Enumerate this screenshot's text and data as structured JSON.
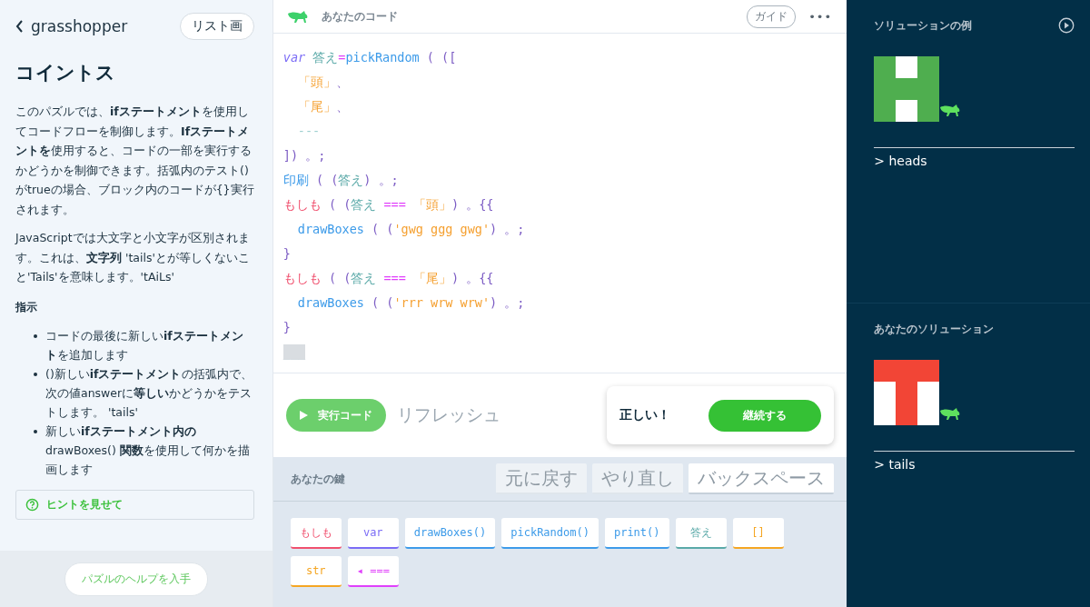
{
  "left": {
    "back_label": "grasshopper",
    "list_button": "リスト画",
    "title": "コイントス",
    "paragraphs": [
      "このパズルでは、**ifステートメント**を使用してコードフローを制御します。**Ifステートメントを**使用すると、コードの一部を実行するかどうかを制御できます。括弧内のテスト()がtrueの場合、ブロック内のコードが{}実行されます。",
      "JavaScriptでは大文字と小文字が区別されます。これは、**文字列** 'tails'とが等しくないこと'Tails'を意味します。'tAiLs'"
    ],
    "instructions_heading": "指示",
    "instructions": [
      "コードの最後に新しい**ifステートメント**を追加します",
      "()新しい**ifステートメント**の括弧内で、次の値answerに**等しい**かどうかをテストします。 'tails'",
      "新しい**ifステートメント内の** drawBoxes() **関数**を使用して何かを描画します"
    ],
    "hint_button": "ヒントを見せて",
    "help_button": "パズルのヘルプを入手"
  },
  "editor": {
    "title": "あなたのコード",
    "guide_button": "ガイド",
    "menu_button": "•••",
    "lines": [
      {
        "indent": false,
        "tokens": [
          {
            "kind": "var",
            "text": "var"
          },
          {
            "kind": "ident",
            "text": " 答え"
          },
          {
            "kind": "op",
            "text": "="
          },
          {
            "kind": "func",
            "text": "pickRandom"
          },
          {
            "kind": "punct",
            "text": " ( (["
          }
        ]
      },
      {
        "indent": true,
        "tokens": [
          {
            "kind": "str",
            "text": "「頭」"
          },
          {
            "kind": "punct",
            "text": "、"
          }
        ]
      },
      {
        "indent": true,
        "tokens": [
          {
            "kind": "str",
            "text": "「尾」"
          },
          {
            "kind": "punct",
            "text": "、"
          }
        ]
      },
      {
        "indent": true,
        "tokens": [
          {
            "kind": "slot",
            "text": "---"
          }
        ]
      },
      {
        "indent": false,
        "tokens": [
          {
            "kind": "punct",
            "text": "]) 。;"
          }
        ]
      },
      {
        "indent": false,
        "tokens": [
          {
            "kind": "func",
            "text": "印刷"
          },
          {
            "kind": "punct",
            "text": " ( ("
          },
          {
            "kind": "ident",
            "text": "答え"
          },
          {
            "kind": "punct",
            "text": ") 。;"
          }
        ]
      },
      {
        "indent": false,
        "tokens": [
          {
            "kind": "kw",
            "text": "もしも"
          },
          {
            "kind": "punct",
            "text": " ( ("
          },
          {
            "kind": "ident",
            "text": "答え"
          },
          {
            "kind": "op",
            "text": " === "
          },
          {
            "kind": "str",
            "text": "「頭」"
          },
          {
            "kind": "punct",
            "text": ") 。{{"
          }
        ]
      },
      {
        "indent": true,
        "tokens": [
          {
            "kind": "func",
            "text": "drawBoxes"
          },
          {
            "kind": "punct",
            "text": " ( ("
          },
          {
            "kind": "str",
            "text": "'gwg ggg gwg'"
          },
          {
            "kind": "punct",
            "text": ") 。;"
          }
        ]
      },
      {
        "indent": false,
        "tokens": [
          {
            "kind": "punct",
            "text": "}"
          }
        ]
      },
      {
        "indent": false,
        "tokens": [
          {
            "kind": "kw",
            "text": "もしも"
          },
          {
            "kind": "punct",
            "text": " ( ("
          },
          {
            "kind": "ident",
            "text": "答え"
          },
          {
            "kind": "op",
            "text": " === "
          },
          {
            "kind": "str",
            "text": "「尾」"
          },
          {
            "kind": "punct",
            "text": ") 。{{"
          }
        ]
      },
      {
        "indent": true,
        "tokens": [
          {
            "kind": "func",
            "text": "drawBoxes"
          },
          {
            "kind": "punct",
            "text": " ( ("
          },
          {
            "kind": "str",
            "text": "'rrr wrw wrw'"
          },
          {
            "kind": "punct",
            "text": ") 。;"
          }
        ]
      },
      {
        "indent": false,
        "tokens": [
          {
            "kind": "punct",
            "text": "}"
          }
        ]
      },
      {
        "indent": false,
        "tokens": [
          {
            "kind": "cursor",
            "text": "___"
          }
        ]
      }
    ],
    "run_button": "実行コード",
    "refresh_button": "リフレッシュ",
    "result": {
      "message": "正しい！",
      "continue_button": "継続する"
    }
  },
  "keys": {
    "title": "あなたの鍵",
    "actions": [
      {
        "label": "元に戻す",
        "disabled": true
      },
      {
        "label": "やり直し",
        "disabled": true
      },
      {
        "label": "バックスペース",
        "disabled": false
      }
    ],
    "items": [
      {
        "label": "もしも",
        "color": "#f0506e"
      },
      {
        "label": "var",
        "color": "#7b6cf6"
      },
      {
        "label": "drawBoxes()",
        "color": "#3d9be9"
      },
      {
        "label": "pickRandom()",
        "color": "#3d9be9"
      },
      {
        "label": "print()",
        "color": "#3d9be9"
      },
      {
        "label": "答え",
        "color": "#5aa9a8"
      },
      {
        "label": "[]",
        "color": "#f5a623"
      },
      {
        "label": "str",
        "color": "#f5a623"
      },
      {
        "label": "◂ ===",
        "color": "#e040fb"
      }
    ]
  },
  "solutions": [
    {
      "title": "ソリューションの例",
      "play": true,
      "cells": [
        {
          "color": "#4fae4f"
        },
        {
          "color": "#ffffff"
        },
        {
          "color": "#4fae4f"
        },
        {
          "color": "#4fae4f"
        },
        {
          "color": "#4fae4f"
        },
        {
          "color": "#4fae4f"
        },
        {
          "color": "#4fae4f"
        },
        {
          "color": "#ffffff"
        },
        {
          "color": "#4fae4f"
        }
      ],
      "output": "> heads"
    },
    {
      "title": "あなたのソリューション",
      "play": false,
      "cells": [
        {
          "color": "#f24536"
        },
        {
          "color": "#f24536"
        },
        {
          "color": "#f24536"
        },
        {
          "color": "#ffffff"
        },
        {
          "color": "#f24536"
        },
        {
          "color": "#ffffff"
        },
        {
          "color": "#ffffff"
        },
        {
          "color": "#f24536"
        },
        {
          "color": "#ffffff"
        }
      ],
      "output": "> tails"
    }
  ]
}
